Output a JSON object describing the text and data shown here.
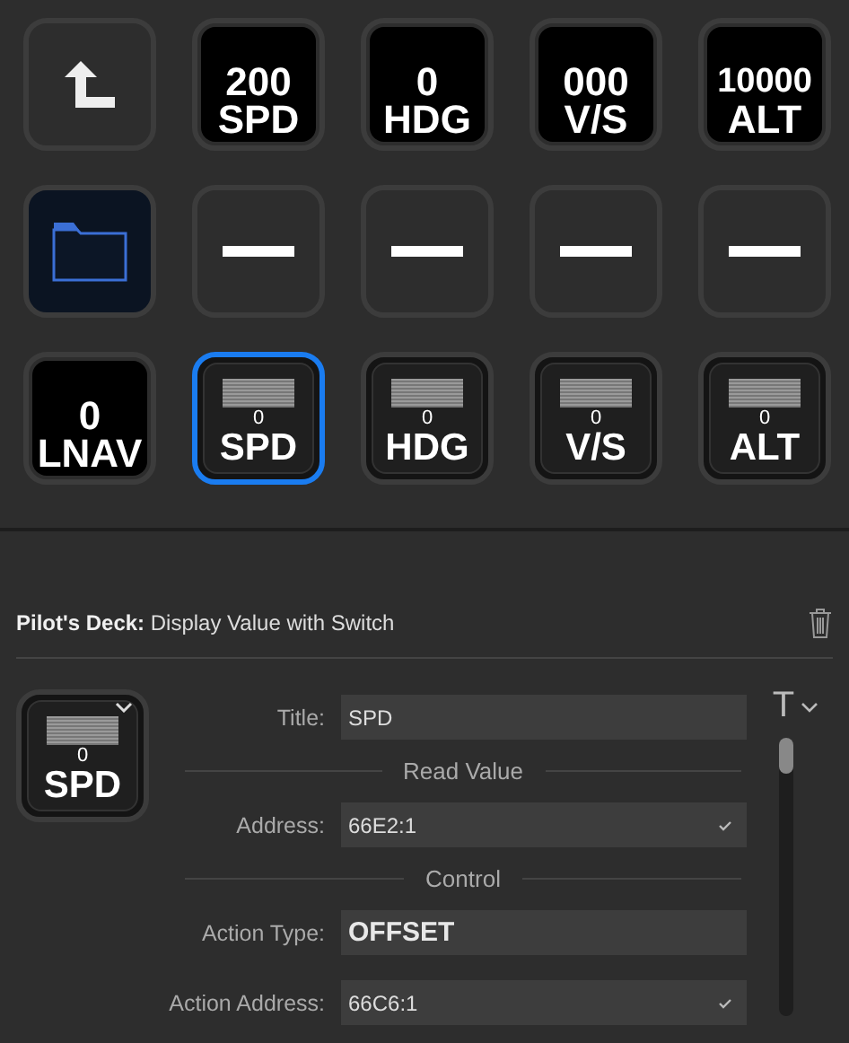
{
  "keys": [
    {
      "kind": "back",
      "selected": false
    },
    {
      "kind": "value",
      "value": "200",
      "label": "SPD",
      "selected": false
    },
    {
      "kind": "value",
      "value": "0",
      "label": "HDG",
      "selected": false
    },
    {
      "kind": "value",
      "value": "000",
      "label": "V/S",
      "selected": false
    },
    {
      "kind": "value",
      "value": "10000",
      "label": "ALT",
      "selected": false
    },
    {
      "kind": "folder",
      "selected": false
    },
    {
      "kind": "empty",
      "selected": false
    },
    {
      "kind": "empty",
      "selected": false
    },
    {
      "kind": "empty",
      "selected": false
    },
    {
      "kind": "empty",
      "selected": false
    },
    {
      "kind": "value",
      "value": "0",
      "label": "LNAV",
      "selected": false
    },
    {
      "kind": "switch",
      "value": "0",
      "label": "SPD",
      "selected": true
    },
    {
      "kind": "switch",
      "value": "0",
      "label": "HDG",
      "selected": false
    },
    {
      "kind": "switch",
      "value": "0",
      "label": "V/S",
      "selected": false
    },
    {
      "kind": "switch",
      "value": "0",
      "label": "ALT",
      "selected": false
    }
  ],
  "inspector": {
    "heading": "**Pilot's Deck:** Display Value with Switch",
    "preview": {
      "kind": "switch",
      "value": "0",
      "label": "SPD",
      "selected": false
    },
    "title_style_button": "T",
    "rows": [
      {
        "kind": "text",
        "label": "Title:",
        "value": "SPD"
      },
      {
        "kind": "section",
        "label": "Read Value"
      },
      {
        "kind": "combo",
        "label": "Address:",
        "value": "66E2:1"
      },
      {
        "kind": "section",
        "label": "Control"
      },
      {
        "kind": "select",
        "label": "Action Type:",
        "value": "OFFSET"
      },
      {
        "kind": "combo",
        "label": "Action Address:",
        "value": "66C6:1"
      }
    ]
  }
}
